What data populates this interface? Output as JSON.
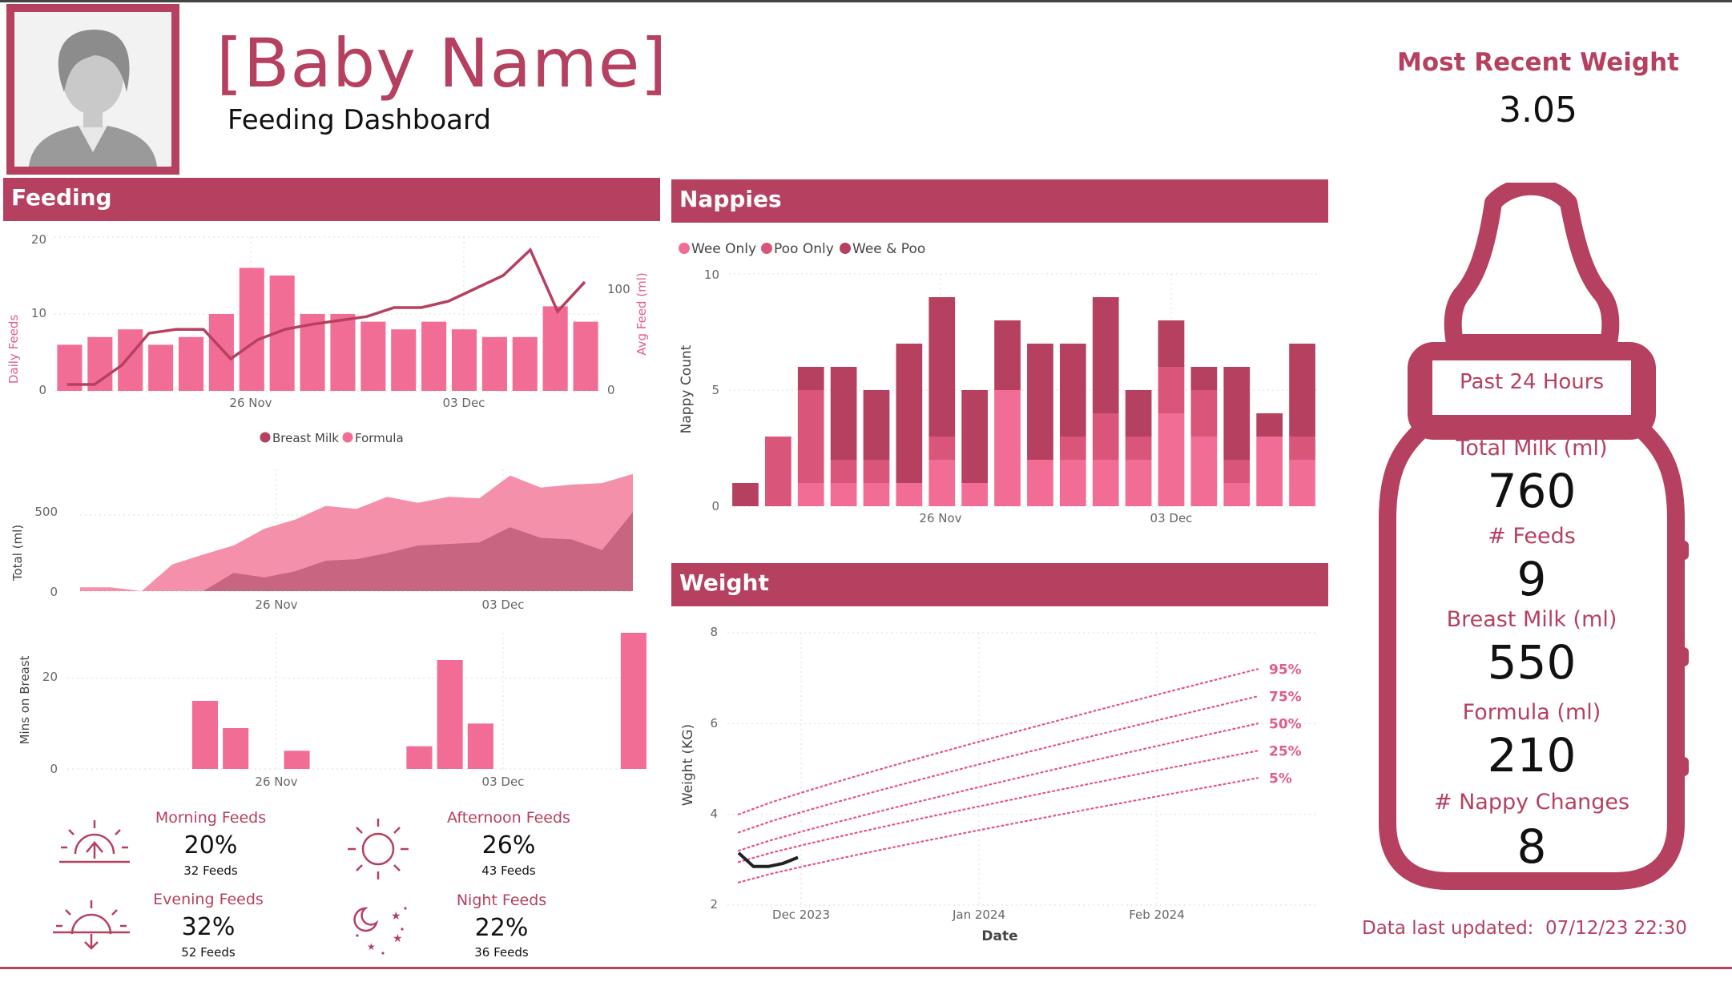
{
  "header": {
    "baby_name": "[Baby Name]",
    "subtitle": "Feeding Dashboard",
    "avatar_icon": "user-silhouette-icon"
  },
  "kpi": {
    "recent_weight_label": "Most Recent Weight",
    "recent_weight_value": "3.05"
  },
  "sections": {
    "feeding": "Feeding",
    "nappies": "Nappies",
    "weight": "Weight"
  },
  "colors": {
    "brand": "#b5405f",
    "pink": "#f26d95",
    "mid": "#d9567a",
    "dark": "#b5405f"
  },
  "chart_data": [
    {
      "id": "daily-feeds",
      "type": "bar",
      "xlabel": "",
      "ylabel": "Daily Feeds",
      "y2label": "Avg Feed (ml)",
      "ylim": [
        0,
        20
      ],
      "y2lim": [
        0,
        120
      ],
      "x_ticks": [
        "26 Nov",
        "03 Dec"
      ],
      "y_ticks": [
        0,
        10,
        20
      ],
      "y2_ticks": [
        0,
        100
      ],
      "bar_values": [
        6,
        7,
        8,
        6,
        7,
        10,
        16,
        15,
        10,
        10,
        9,
        8,
        9,
        8,
        7,
        7,
        11,
        9
      ],
      "line_values": [
        5,
        5,
        20,
        45,
        48,
        48,
        25,
        40,
        48,
        52,
        55,
        58,
        65,
        65,
        70,
        80,
        90,
        110,
        62,
        85
      ],
      "grid": true
    },
    {
      "id": "milk-total",
      "type": "area",
      "ylabel": "Total (ml)",
      "ylim": [
        0,
        800
      ],
      "x_ticks": [
        "26 Nov",
        "03 Dec"
      ],
      "y_ticks": [
        0,
        500
      ],
      "series": [
        {
          "name": "Breast Milk",
          "values": [
            0,
            0,
            0,
            0,
            0,
            120,
            90,
            130,
            200,
            210,
            250,
            300,
            310,
            320,
            420,
            350,
            340,
            270,
            520
          ]
        },
        {
          "name": "Formula",
          "values": [
            25,
            25,
            0,
            175,
            240,
            300,
            410,
            470,
            560,
            540,
            620,
            580,
            620,
            610,
            760,
            680,
            700,
            710,
            770
          ]
        }
      ],
      "legend": "top"
    },
    {
      "id": "mins-on-breast",
      "type": "bar",
      "ylabel": "Mins on Breast",
      "ylim": [
        0,
        30
      ],
      "x_ticks": [
        "26 Nov",
        "03 Dec"
      ],
      "y_ticks": [
        0,
        20
      ],
      "values": [
        0,
        0,
        0,
        0,
        15,
        9,
        0,
        4,
        0,
        0,
        0,
        5,
        24,
        10,
        0,
        0,
        0,
        0,
        30
      ],
      "grid": true
    },
    {
      "id": "nappies",
      "type": "bar",
      "ylabel": "Nappy Count",
      "ylim": [
        0,
        10
      ],
      "x_ticks": [
        "26 Nov",
        "03 Dec"
      ],
      "y_ticks": [
        0,
        5,
        10
      ],
      "stacked": true,
      "series": [
        {
          "name": "Wee Only",
          "values": [
            0,
            0,
            1,
            1,
            1,
            1,
            2,
            1,
            5,
            2,
            2,
            2,
            2,
            4,
            3,
            1,
            3,
            2
          ]
        },
        {
          "name": "Poo Only",
          "values": [
            0,
            3,
            4,
            1,
            1,
            0,
            1,
            0,
            0,
            0,
            1,
            2,
            1,
            2,
            2,
            1,
            0,
            1
          ]
        },
        {
          "name": "Wee & Poo",
          "values": [
            1,
            0,
            1,
            4,
            3,
            6,
            6,
            4,
            3,
            5,
            4,
            5,
            2,
            2,
            1,
            4,
            1,
            4
          ]
        }
      ],
      "legend": "top-left"
    },
    {
      "id": "weight",
      "type": "line",
      "xlabel": "Date",
      "ylabel": "Weight (KG)",
      "ylim": [
        2,
        8
      ],
      "x_ticks": [
        "Dec 2023",
        "Jan 2024",
        "Feb 2024"
      ],
      "y_ticks": [
        2,
        4,
        6,
        8
      ],
      "actual": [
        3.15,
        2.85,
        2.85,
        2.92,
        3.05
      ],
      "percentiles": [
        {
          "name": "95%",
          "start": 4.0,
          "end": 7.2
        },
        {
          "name": "75%",
          "start": 3.6,
          "end": 6.6
        },
        {
          "name": "50%",
          "start": 3.2,
          "end": 6.0
        },
        {
          "name": "25%",
          "start": 2.95,
          "end": 5.4
        },
        {
          "name": "5%",
          "start": 2.5,
          "end": 4.8
        }
      ],
      "grid": true
    }
  ],
  "feed_times": {
    "morning": {
      "title": "Morning Feeds",
      "pct": "20%",
      "count": "32 Feeds",
      "icon": "sunrise-icon"
    },
    "afternoon": {
      "title": "Afternoon Feeds",
      "pct": "26%",
      "count": "43 Feeds",
      "icon": "sun-icon"
    },
    "evening": {
      "title": "Evening Feeds",
      "pct": "32%",
      "count": "52 Feeds",
      "icon": "sunset-icon"
    },
    "night": {
      "title": "Night Feeds",
      "pct": "22%",
      "count": "36 Feeds",
      "icon": "moon-stars-icon"
    }
  },
  "bottle": {
    "label": "Past 24 Hours",
    "total_milk_label": "Total Milk (ml)",
    "total_milk_value": "760",
    "feeds_label": "# Feeds",
    "feeds_value": "9",
    "breast_label": "Breast Milk (ml)",
    "breast_value": "550",
    "formula_label": "Formula (ml)",
    "formula_value": "210",
    "nappy_label": "# Nappy Changes",
    "nappy_value": "8"
  },
  "footer": {
    "updated_label": "Data last updated:",
    "updated_value": "07/12/23 22:30"
  }
}
